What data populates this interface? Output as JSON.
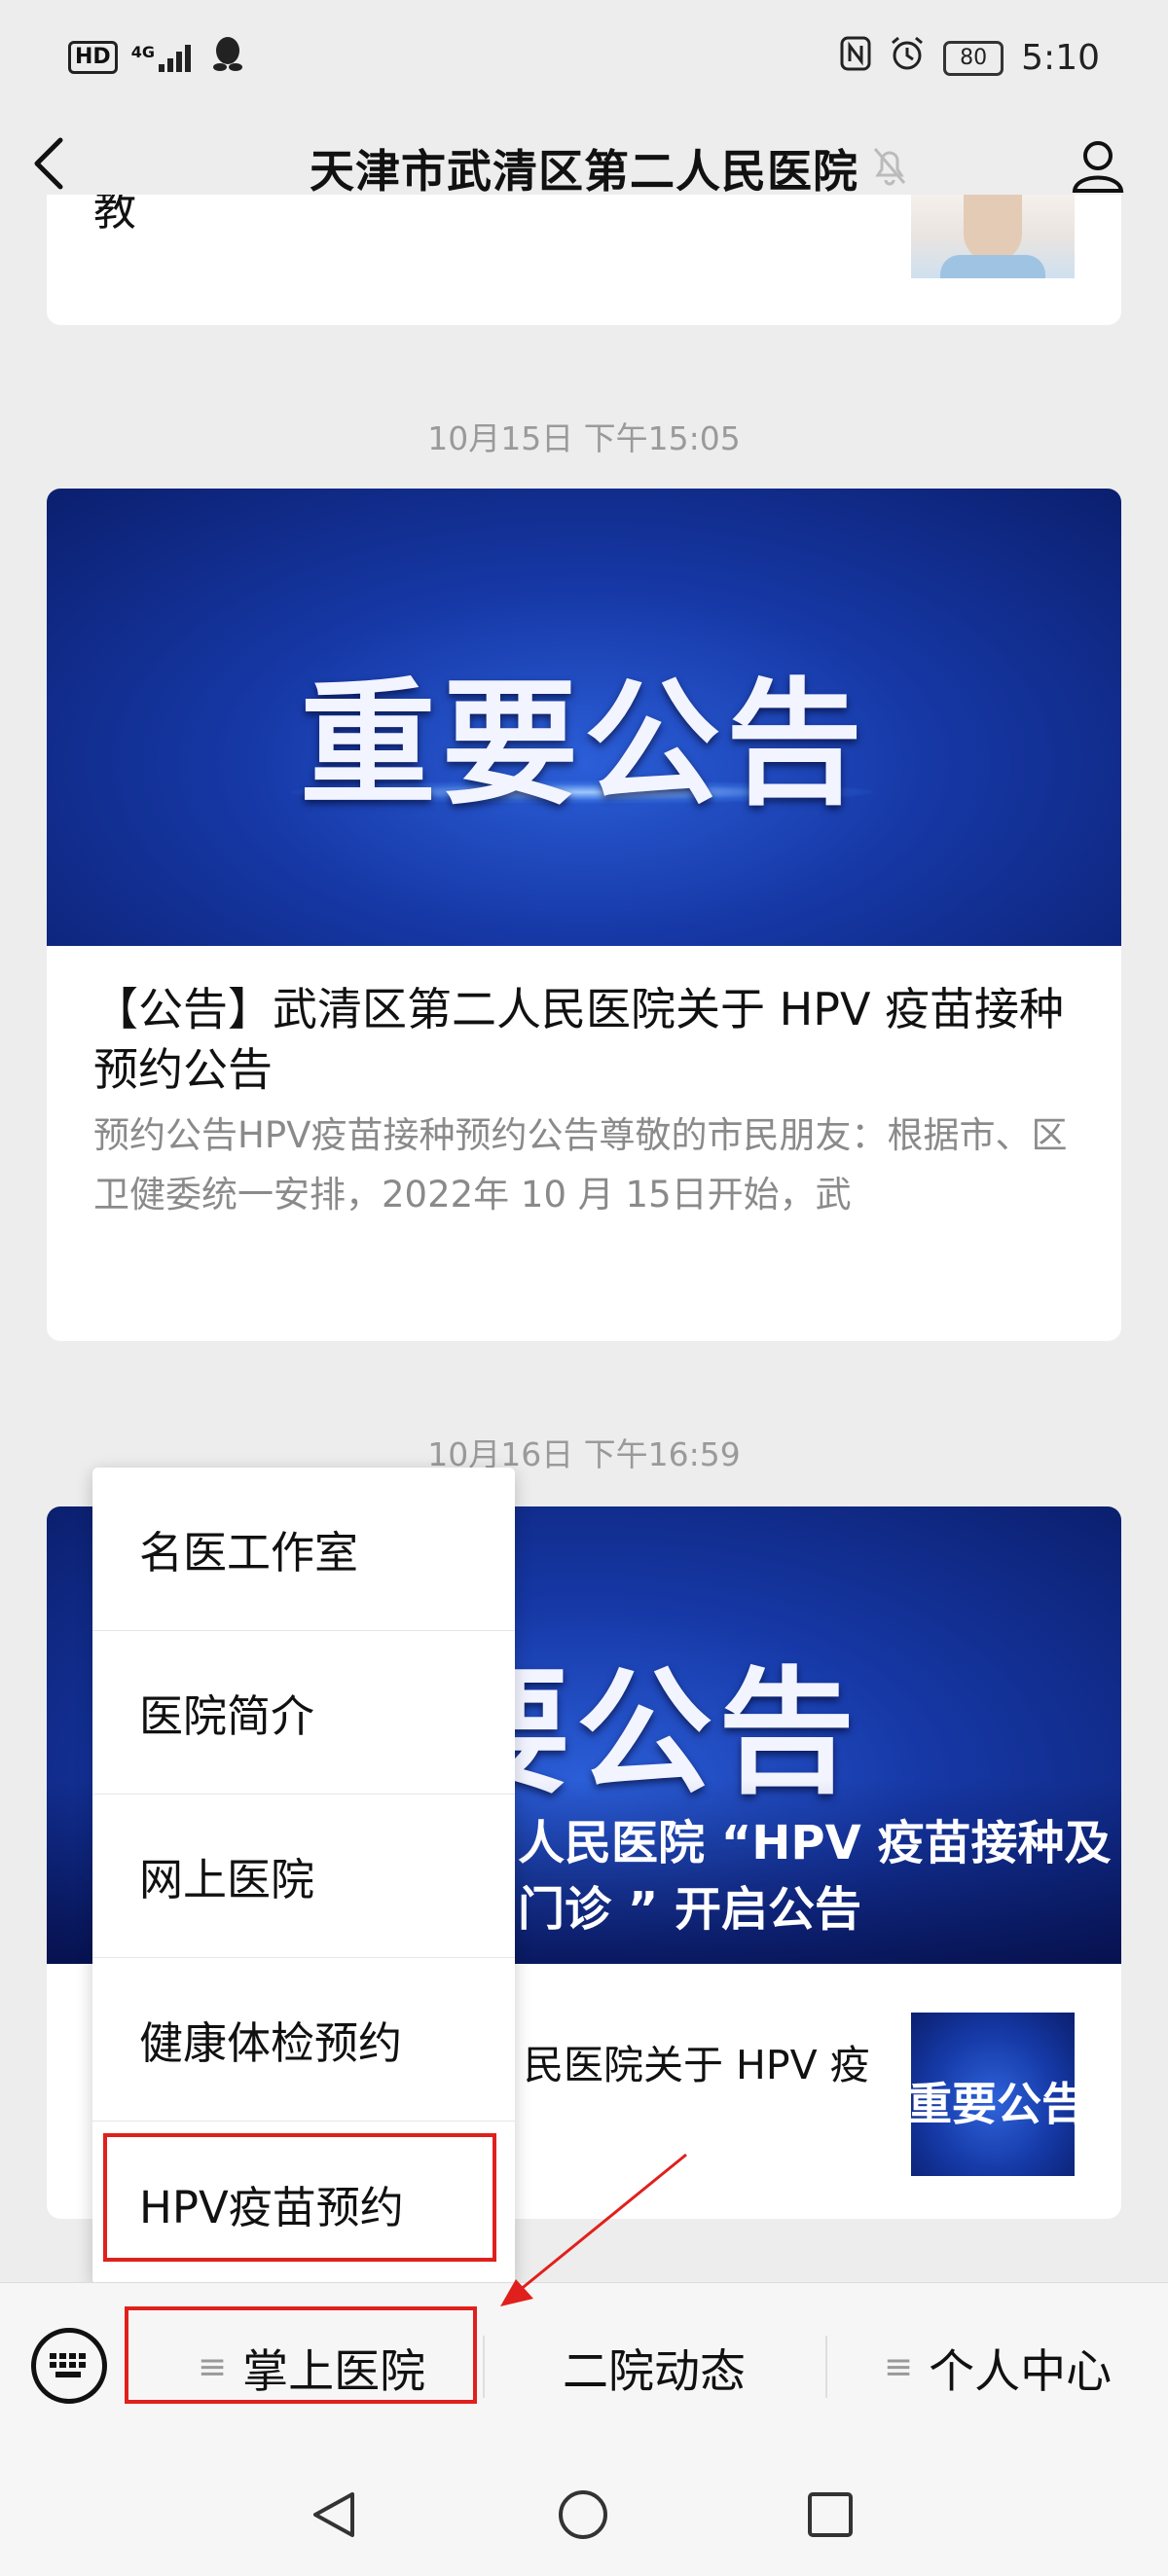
{
  "status_bar": {
    "hd": "HD",
    "network": "4G",
    "time": "5:10",
    "battery": "80",
    "icons": [
      "signal-icon",
      "qq-icon",
      "nfc-icon",
      "alarm-icon"
    ]
  },
  "header": {
    "title": "天津市武清区第二人民医院",
    "icons": [
      "back-icon",
      "mute-bell-icon",
      "profile-icon"
    ]
  },
  "partial_card": {
    "text": "教"
  },
  "articles": [
    {
      "timestamp": "10月15日 下午15:05",
      "banner_text": "重要公告",
      "title": "【公告】武清区第二人民医院关于 HPV 疫苗接种预约公告",
      "summary": "预约公告HPV疫苗接种预约公告尊敬的市民朋友：根据市、区卫健委统一安排，2022年 10 月 15日开始，武"
    },
    {
      "timestamp": "10月16日 下午16:59",
      "banner_text": "要公告",
      "title_line1": "人民医院 “HPV 疫苗接种及",
      "title_line2": "门诊 ” 开启公告",
      "sub_item": "民医院关于 HPV 疫",
      "thumb_text": "重要公告"
    }
  ],
  "popup_menu": {
    "items": [
      "名医工作室",
      "医院简介",
      "网上医院",
      "健康体检预约",
      "HPV疫苗预约"
    ]
  },
  "tab_bar": {
    "tabs": [
      "掌上医院",
      "二院动态",
      "个人中心"
    ],
    "icons": [
      "keyboard-icon",
      "menu-icon"
    ]
  },
  "nav_bar": {
    "icons": [
      "back-triangle-icon",
      "home-circle-icon",
      "recents-square-icon"
    ]
  },
  "colors": {
    "background": "#ededed",
    "annotation_red": "#e0201c",
    "banner_blue": "#1638a6"
  }
}
